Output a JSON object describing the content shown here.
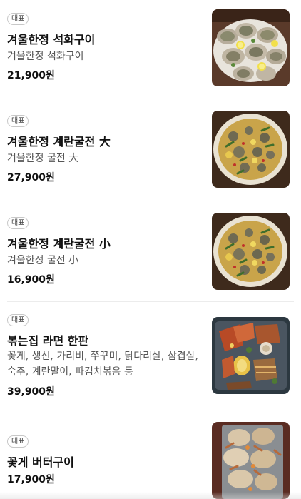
{
  "menu_items": [
    {
      "badge": "대표",
      "name": "겨울한정 석화구이",
      "description": "겨울한정 석화구이",
      "price": "21,900원",
      "image_icon": "oyster-platter-photo"
    },
    {
      "badge": "대표",
      "name": "겨울한정 계란굴전 大",
      "description": "겨울한정 굴전 大",
      "price": "27,900원",
      "image_icon": "oyster-pancake-photo"
    },
    {
      "badge": "대표",
      "name": "겨울한정 계란굴전 小",
      "description": "겨울한정 굴전 小",
      "price": "16,900원",
      "image_icon": "oyster-pancake-photo"
    },
    {
      "badge": "대표",
      "name": "볶는집 라면 한판",
      "description": "꽃게, 생선, 가리비, 쭈꾸미, 닭다리살, 삼겹살, 숙주, 계란말이, 파김치볶음 등",
      "price": "39,900원",
      "image_icon": "seafood-platter-photo"
    },
    {
      "badge": "대표",
      "name": "꽃게 버터구이",
      "description": "",
      "price": "17,900원",
      "image_icon": "butter-crab-photo"
    }
  ]
}
